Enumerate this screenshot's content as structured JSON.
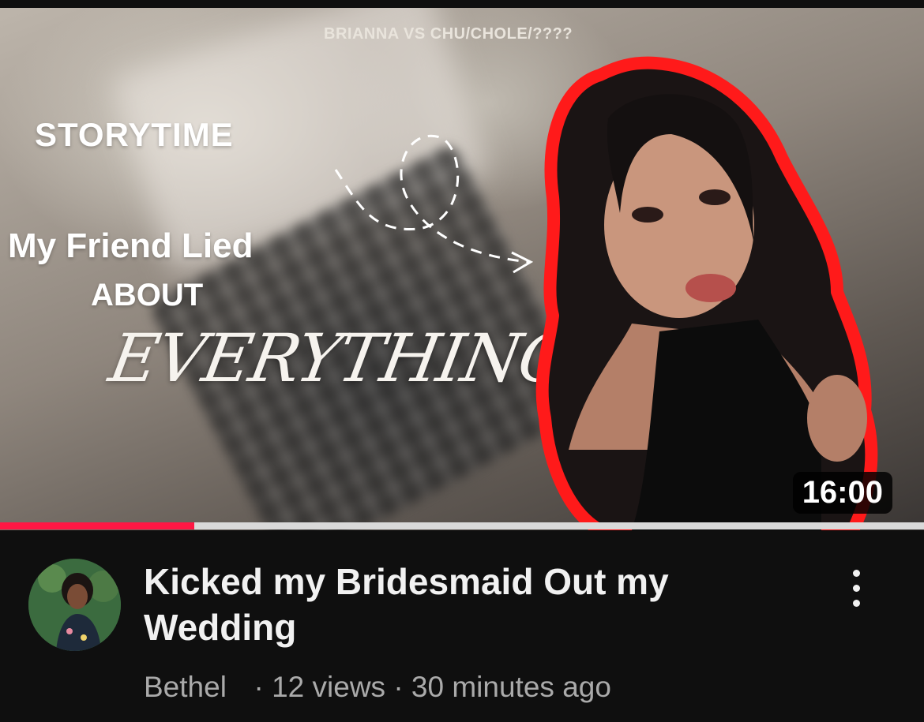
{
  "video": {
    "thumbnail": {
      "top_text": "BRIANNA VS CHU/CHOLE/????",
      "line1": "STORYTIME",
      "line2": "My Friend Lied",
      "line3": "ABOUT",
      "line4": "EVERYTHING"
    },
    "duration": "16:00",
    "watch_progress_fraction": 0.21,
    "title": "Kicked my Bridesmaid Out my Wedding",
    "channel": "Bethel",
    "views": "· 12 views",
    "age": "· 30 minutes ago"
  },
  "colors": {
    "background": "#0f0f0f",
    "progress": "#ff1744",
    "progress_track": "#d9d9d9",
    "outline": "#ff1a1a"
  },
  "icons": {
    "menu": "more-vertical-icon"
  }
}
